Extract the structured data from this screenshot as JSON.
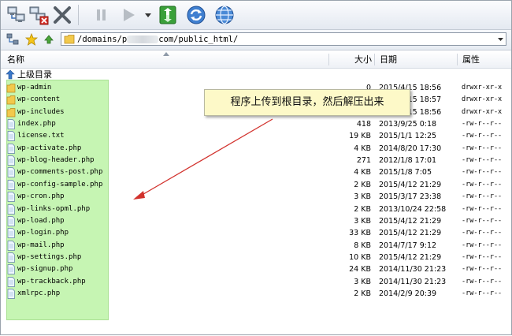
{
  "toolbar": {
    "buttons": [
      {
        "name": "connect-icon"
      },
      {
        "name": "disconnect-icon"
      },
      {
        "name": "cancel-icon"
      },
      {
        "name": "pause-icon"
      },
      {
        "name": "play-icon"
      },
      {
        "name": "sync-icon"
      },
      {
        "name": "refresh-icon"
      },
      {
        "name": "globe-icon"
      }
    ]
  },
  "address": {
    "path_prefix": "/domains/p",
    "path_suffix": "com/public_html/"
  },
  "columns": {
    "name": "名称",
    "size": "大小",
    "date": "日期",
    "perm": "属性"
  },
  "parent": "上级目录",
  "callout": "程序上传到根目录，然后解压出来",
  "files": [
    {
      "name": "wp-admin",
      "size": "0",
      "date": "2015/4/15 18:56",
      "perm": "drwxr-xr-x",
      "folder": true
    },
    {
      "name": "wp-content",
      "size": "0",
      "date": "2015/4/15 18:57",
      "perm": "drwxr-xr-x",
      "folder": true
    },
    {
      "name": "wp-includes",
      "size": "0",
      "date": "2015/4/15 18:56",
      "perm": "drwxr-xr-x",
      "folder": true
    },
    {
      "name": "index.php",
      "size": "418",
      "date": "2013/9/25 0:18",
      "perm": "-rw-r--r--"
    },
    {
      "name": "license.txt",
      "size": "19 KB",
      "date": "2015/1/1 12:25",
      "perm": "-rw-r--r--"
    },
    {
      "name": "wp-activate.php",
      "size": "4 KB",
      "date": "2014/8/20 17:30",
      "perm": "-rw-r--r--"
    },
    {
      "name": "wp-blog-header.php",
      "size": "271",
      "date": "2012/1/8 17:01",
      "perm": "-rw-r--r--"
    },
    {
      "name": "wp-comments-post.php",
      "size": "4 KB",
      "date": "2015/1/8 7:05",
      "perm": "-rw-r--r--"
    },
    {
      "name": "wp-config-sample.php",
      "size": "2 KB",
      "date": "2015/4/12 21:29",
      "perm": "-rw-r--r--"
    },
    {
      "name": "wp-cron.php",
      "size": "3 KB",
      "date": "2015/3/17 23:38",
      "perm": "-rw-r--r--"
    },
    {
      "name": "wp-links-opml.php",
      "size": "2 KB",
      "date": "2013/10/24 22:58",
      "perm": "-rw-r--r--"
    },
    {
      "name": "wp-load.php",
      "size": "3 KB",
      "date": "2015/4/12 21:29",
      "perm": "-rw-r--r--"
    },
    {
      "name": "wp-login.php",
      "size": "33 KB",
      "date": "2015/4/12 21:29",
      "perm": "-rw-r--r--"
    },
    {
      "name": "wp-mail.php",
      "size": "8 KB",
      "date": "2014/7/17 9:12",
      "perm": "-rw-r--r--"
    },
    {
      "name": "wp-settings.php",
      "size": "10 KB",
      "date": "2015/4/12 21:29",
      "perm": "-rw-r--r--"
    },
    {
      "name": "wp-signup.php",
      "size": "24 KB",
      "date": "2014/11/30 21:23",
      "perm": "-rw-r--r--"
    },
    {
      "name": "wp-trackback.php",
      "size": "3 KB",
      "date": "2014/11/30 21:23",
      "perm": "-rw-r--r--"
    },
    {
      "name": "xmlrpc.php",
      "size": "2 KB",
      "date": "2014/2/9 20:39",
      "perm": "-rw-r--r--"
    }
  ]
}
